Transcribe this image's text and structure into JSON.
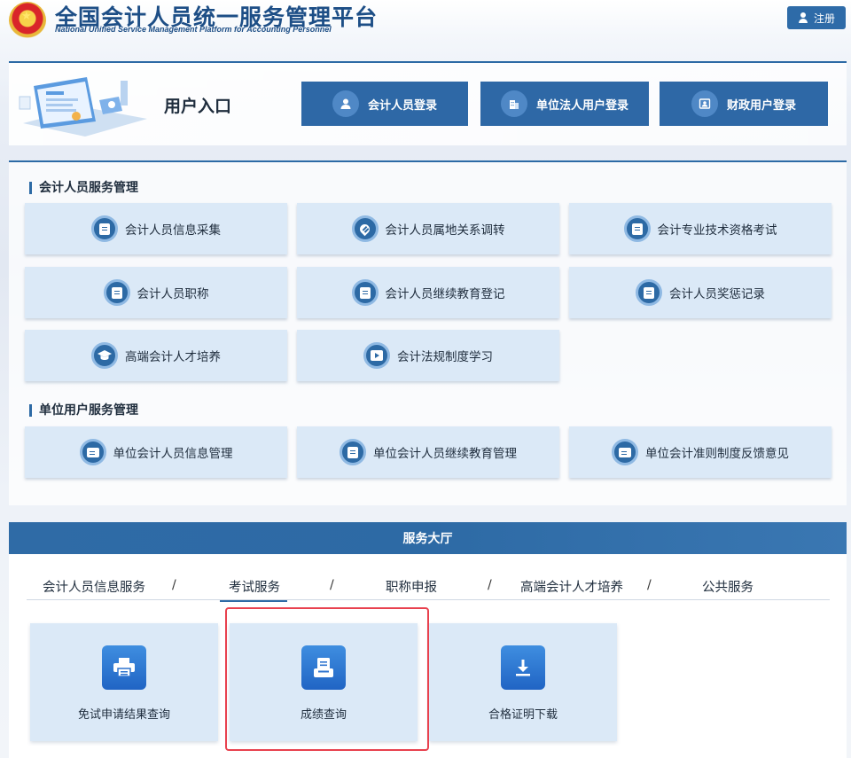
{
  "header": {
    "title": "全国会计人员统一服务管理平台",
    "subtitle": "National Unified Service Management Platform for Accounting Personnel",
    "register_label": "注册"
  },
  "entry": {
    "title": "用户入口",
    "buttons": [
      {
        "label": "会计人员登录",
        "icon": "user-icon"
      },
      {
        "label": "单位法人用户登录",
        "icon": "building-icon"
      },
      {
        "label": "财政用户登录",
        "icon": "id-card-icon"
      }
    ]
  },
  "services": {
    "accountant_section": "会计人员服务管理",
    "accountant_items": [
      {
        "label": "会计人员信息采集",
        "icon": "form-edit-icon"
      },
      {
        "label": "会计人员属地关系调转",
        "icon": "location-icon"
      },
      {
        "label": "会计专业技术资格考试",
        "icon": "exam-icon"
      },
      {
        "label": "会计人员职称",
        "icon": "document-icon"
      },
      {
        "label": "会计人员继续教育登记",
        "icon": "education-register-icon"
      },
      {
        "label": "会计人员奖惩记录",
        "icon": "record-search-icon"
      },
      {
        "label": "高端会计人才培养",
        "icon": "graduation-cap-icon"
      },
      {
        "label": "会计法规制度学习",
        "icon": "video-play-icon"
      }
    ],
    "unit_section": "单位用户服务管理",
    "unit_items": [
      {
        "label": "单位会计人员信息管理",
        "icon": "info-management-icon"
      },
      {
        "label": "单位会计人员继续教育管理",
        "icon": "education-management-icon"
      },
      {
        "label": "单位会计准则制度反馈意见",
        "icon": "feedback-icon"
      }
    ]
  },
  "hall": {
    "title": "服务大厅",
    "tabs": [
      "会计人员信息服务",
      "考试服务",
      "职称申报",
      "高端会计人才培养",
      "公共服务"
    ],
    "separator": "/",
    "active_tab": "考试服务",
    "cards": [
      {
        "label": "免试申请结果查询",
        "icon": "printer-icon"
      },
      {
        "label": "成绩查询",
        "icon": "score-icon"
      },
      {
        "label": "合格证明下载",
        "icon": "download-icon"
      }
    ]
  },
  "colors": {
    "primary": "#2d6aa5",
    "card_bg": "#dbe9f7",
    "highlight": "#e8414e"
  }
}
